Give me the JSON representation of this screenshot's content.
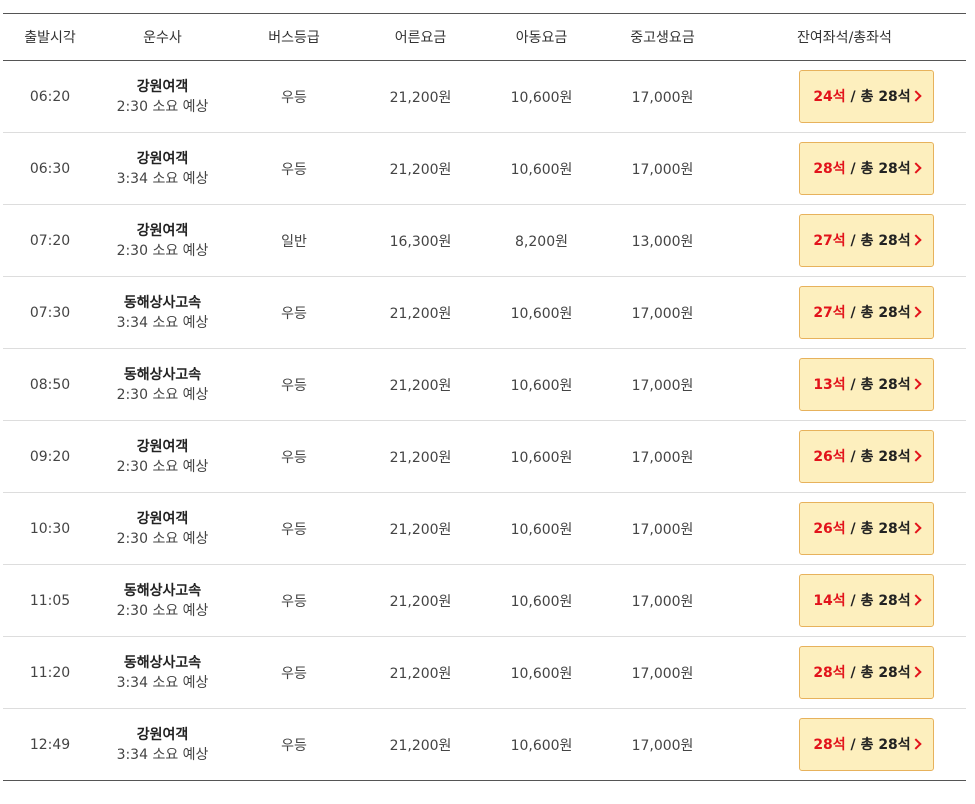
{
  "headers": {
    "depart_time": "출발시각",
    "carrier": "운수사",
    "bus_grade": "버스등급",
    "adult_fare": "어른요금",
    "child_fare": "아동요금",
    "student_fare": "중고생요금",
    "seats": "잔여좌석/총좌석"
  },
  "seat_separator": " / ",
  "rows": [
    {
      "time": "06:20",
      "carrier": "강원여객",
      "duration": "2:30 소요 예상",
      "grade": "우등",
      "adult": "21,200원",
      "child": "10,600원",
      "student": "17,000원",
      "remaining": "24석",
      "total": "총 28석"
    },
    {
      "time": "06:30",
      "carrier": "강원여객",
      "duration": "3:34 소요 예상",
      "grade": "우등",
      "adult": "21,200원",
      "child": "10,600원",
      "student": "17,000원",
      "remaining": "28석",
      "total": "총 28석"
    },
    {
      "time": "07:20",
      "carrier": "강원여객",
      "duration": "2:30 소요 예상",
      "grade": "일반",
      "adult": "16,300원",
      "child": "8,200원",
      "student": "13,000원",
      "remaining": "27석",
      "total": "총 28석"
    },
    {
      "time": "07:30",
      "carrier": "동해상사고속",
      "duration": "3:34 소요 예상",
      "grade": "우등",
      "adult": "21,200원",
      "child": "10,600원",
      "student": "17,000원",
      "remaining": "27석",
      "total": "총 28석"
    },
    {
      "time": "08:50",
      "carrier": "동해상사고속",
      "duration": "2:30 소요 예상",
      "grade": "우등",
      "adult": "21,200원",
      "child": "10,600원",
      "student": "17,000원",
      "remaining": "13석",
      "total": "총 28석"
    },
    {
      "time": "09:20",
      "carrier": "강원여객",
      "duration": "2:30 소요 예상",
      "grade": "우등",
      "adult": "21,200원",
      "child": "10,600원",
      "student": "17,000원",
      "remaining": "26석",
      "total": "총 28석"
    },
    {
      "time": "10:30",
      "carrier": "강원여객",
      "duration": "2:30 소요 예상",
      "grade": "우등",
      "adult": "21,200원",
      "child": "10,600원",
      "student": "17,000원",
      "remaining": "26석",
      "total": "총 28석"
    },
    {
      "time": "11:05",
      "carrier": "동해상사고속",
      "duration": "2:30 소요 예상",
      "grade": "우등",
      "adult": "21,200원",
      "child": "10,600원",
      "student": "17,000원",
      "remaining": "14석",
      "total": "총 28석"
    },
    {
      "time": "11:20",
      "carrier": "동해상사고속",
      "duration": "3:34 소요 예상",
      "grade": "우등",
      "adult": "21,200원",
      "child": "10,600원",
      "student": "17,000원",
      "remaining": "28석",
      "total": "총 28석"
    },
    {
      "time": "12:49",
      "carrier": "강원여객",
      "duration": "3:34 소요 예상",
      "grade": "우등",
      "adult": "21,200원",
      "child": "10,600원",
      "student": "17,000원",
      "remaining": "28석",
      "total": "총 28석"
    }
  ],
  "icons": {
    "seat_button_arrow": "chevron-right-icon"
  },
  "colors": {
    "remaining_seats": "#e2131b",
    "seat_button_bg": "#fdefbe",
    "seat_button_border": "#e7b25c"
  }
}
